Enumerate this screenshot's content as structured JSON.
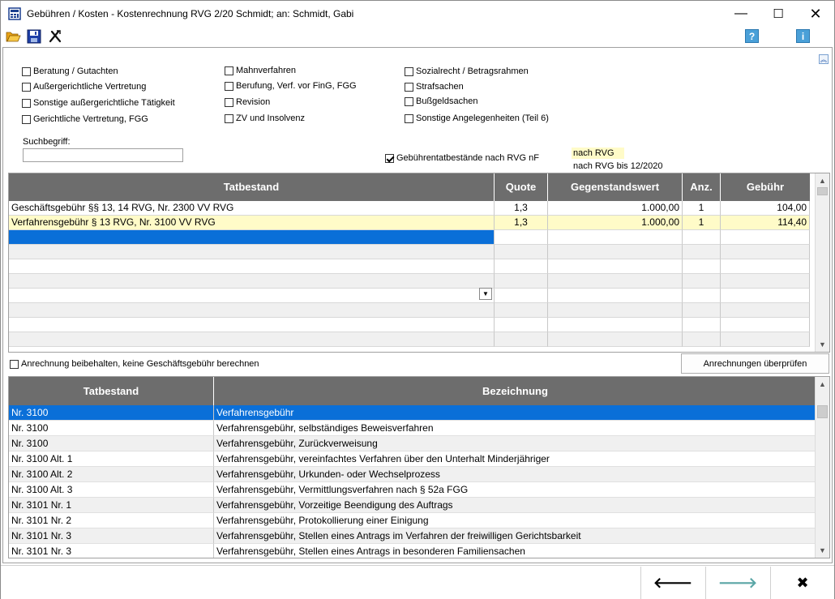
{
  "window": {
    "title": "Gebühren / Kosten - Kostenrechnung RVG 2/20 Schmidt; an: Schmidt, Gabi",
    "minimize": "—",
    "maximize": "☐",
    "close": "✕"
  },
  "toolbar": {
    "open_icon": "folder-open-icon",
    "save_icon": "save-icon",
    "cancel_icon": "tools-cross-icon",
    "help_label": "?",
    "info_label": "i"
  },
  "categories": {
    "col1": [
      "Beratung / Gutachten",
      "Außergerichtliche Vertretung",
      "Sonstige außergerichtliche Tätigkeit",
      "Gerichtliche Vertretung, FGG"
    ],
    "col2": [
      "Mahnverfahren",
      "Berufung, Verf. vor FinG, FGG",
      "Revision",
      "ZV und Insolvenz"
    ],
    "col3": [
      "Sozialrecht / Betragsrahmen",
      "Strafsachen",
      "Bußgeldsachen",
      "Sonstige Angelegenheiten (Teil 6)"
    ]
  },
  "search": {
    "label": "Suchbegriff:",
    "value": ""
  },
  "filter": {
    "label": "Gebührentatbestände nach RVG nF",
    "checked": true
  },
  "legend": {
    "yellow": "nach RVG",
    "white": "nach RVG bis 12/2020",
    "yellow_color": "#fffbc8"
  },
  "fees_table": {
    "columns": [
      "Tatbestand",
      "Quote",
      "Gegenstandswert",
      "Anz.",
      "Gebühr"
    ],
    "rows": [
      [
        "Geschäftsgebühr §§ 13, 14 RVG, Nr. 2300 VV RVG",
        "1,3",
        "1.000,00",
        "1",
        "104,00"
      ],
      [
        "Verfahrensgebühr § 13 RVG, Nr. 3100 VV RVG",
        "1,3",
        "1.000,00",
        "1",
        "114,40"
      ]
    ]
  },
  "anrechnung": {
    "checkbox_label": "Anrechnung beibehalten, keine Geschäftsgebühr berechnen",
    "button_label": "Anrechnungen überprüfen"
  },
  "catalog_table": {
    "columns": [
      "Tatbestand",
      "Bezeichnung"
    ],
    "rows": [
      [
        "Nr. 3100",
        "Verfahrensgebühr"
      ],
      [
        "Nr. 3100",
        "Verfahrensgebühr, selbständiges Beweisverfahren"
      ],
      [
        "Nr. 3100",
        "Verfahrensgebühr, Zurückverweisung"
      ],
      [
        "Nr. 3100 Alt. 1",
        "Verfahrensgebühr, vereinfachtes Verfahren über den Unterhalt Minderjähriger"
      ],
      [
        "Nr. 3100 Alt. 2",
        "Verfahrensgebühr, Urkunden- oder Wechselprozess"
      ],
      [
        "Nr. 3100 Alt. 3",
        "Verfahrensgebühr, Vermittlungsverfahren nach § 52a FGG"
      ],
      [
        "Nr. 3101 Nr. 1",
        "Verfahrensgebühr, Vorzeitige Beendigung des Auftrags"
      ],
      [
        "Nr. 3101 Nr. 2",
        "Verfahrensgebühr, Protokollierung einer Einigung"
      ],
      [
        "Nr. 3101 Nr. 3",
        "Verfahrensgebühr, Stellen eines Antrags im Verfahren der freiwilligen Gerichtsbarkeit"
      ],
      [
        "Nr. 3101 Nr. 3",
        "Verfahrensgebühr, Stellen eines Antrags in besonderen Familiensachen"
      ]
    ]
  },
  "nav": {
    "back": "🡐",
    "forward": "🡒",
    "close": "✖",
    "forward_color": "#5aa6a6"
  },
  "colors": {
    "header_bg": "#6d6d6d",
    "selection": "#0a6fd8"
  }
}
